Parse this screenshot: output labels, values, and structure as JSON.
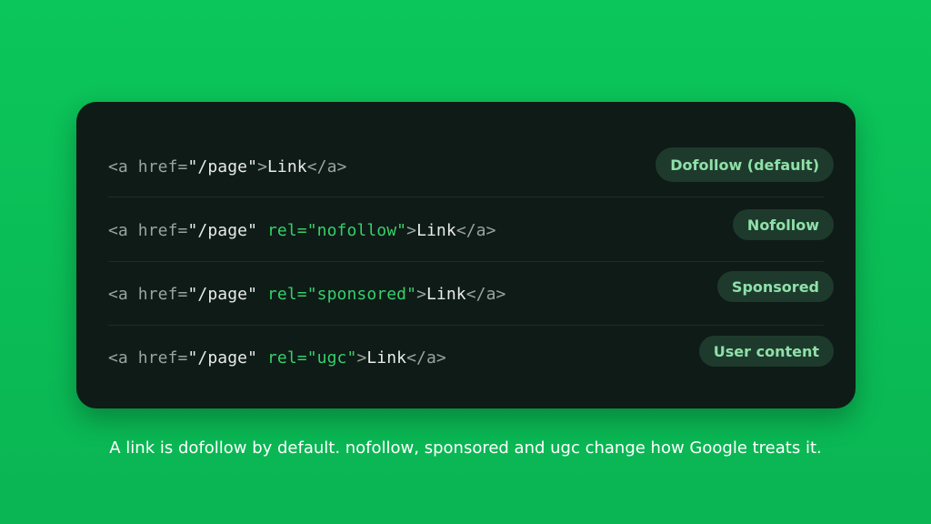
{
  "rows": [
    {
      "code": {
        "open": "<a href=",
        "href": "\"/page\"",
        "rel": "",
        "close_open": ">",
        "link": "Link",
        "end": "</a>"
      },
      "badge": "Dofollow (default)"
    },
    {
      "code": {
        "open": "<a href=",
        "href": "\"/page\"",
        "rel": " rel=\"nofollow\"",
        "close_open": ">",
        "link": "Link",
        "end": "</a>"
      },
      "badge": "Nofollow"
    },
    {
      "code": {
        "open": "<a href=",
        "href": "\"/page\"",
        "rel": " rel=\"sponsored\"",
        "close_open": ">",
        "link": "Link",
        "end": "</a>"
      },
      "badge": "Sponsored"
    },
    {
      "code": {
        "open": "<a href=",
        "href": "\"/page\"",
        "rel": " rel=\"ugc\"",
        "close_open": ">",
        "link": "Link",
        "end": "</a>"
      },
      "badge": "User content"
    }
  ],
  "caption": "A link is dofollow by default. nofollow, sponsored and ugc change how Google treats it.",
  "colors": {
    "background": "#0bc65a",
    "card": "#0f1b17",
    "badge_bg": "#1e3a2d",
    "badge_text": "#8fe0a8",
    "rel_green": "#37cf6b"
  }
}
